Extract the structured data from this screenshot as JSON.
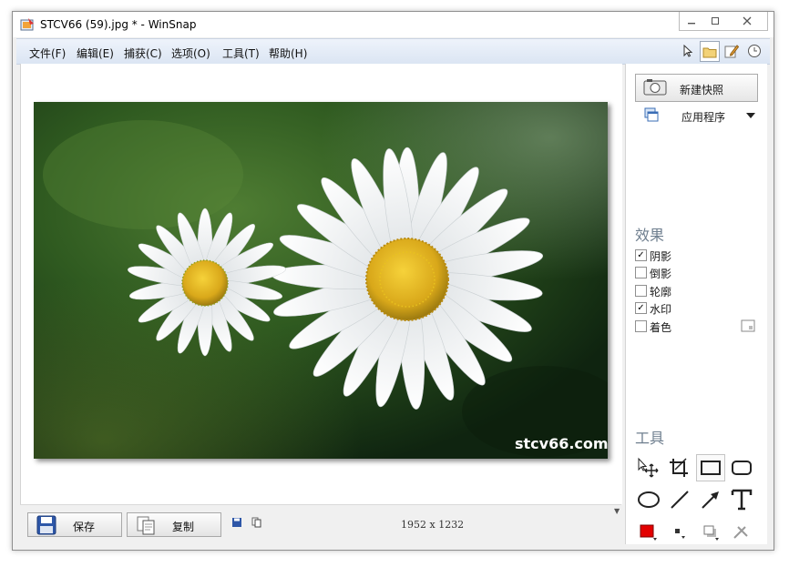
{
  "window": {
    "title": "STCV66 (59).jpg * - WinSnap"
  },
  "menu": [
    "文件(F)",
    "编辑(E)",
    "捕获(C)",
    "选项(O)",
    "工具(T)",
    "帮助(H)"
  ],
  "photo": {
    "watermark": "stcv66.com",
    "dimensions": "1952 x 1232"
  },
  "bottom": {
    "save_label": "保存",
    "copy_label": "复制"
  },
  "panel": {
    "new_snapshot": "新建快照",
    "capture_mode": "应用程序",
    "effects_title": "效果",
    "effects": [
      {
        "label": "阴影",
        "checked": true
      },
      {
        "label": "倒影",
        "checked": false
      },
      {
        "label": "轮廓",
        "checked": false
      },
      {
        "label": "水印",
        "checked": true
      },
      {
        "label": "着色",
        "checked": false
      }
    ],
    "tools_title": "工具"
  },
  "colors": {
    "accent_color": "#e30000",
    "menu_bg": "#dbe5f3"
  }
}
